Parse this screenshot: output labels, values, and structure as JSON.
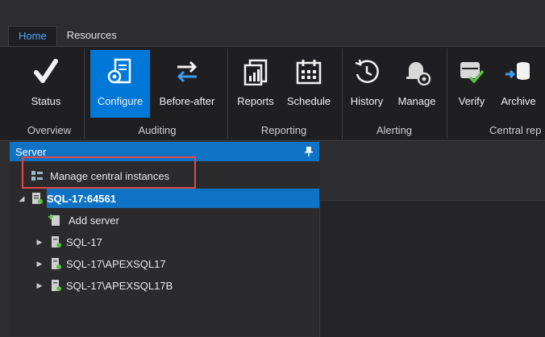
{
  "tabs": [
    {
      "label": "Home",
      "active": true
    },
    {
      "label": "Resources",
      "active": false
    }
  ],
  "ribbon": {
    "buttons": [
      {
        "label": "Status",
        "icon": "checkmark-icon"
      },
      {
        "label": "Configure",
        "icon": "server-gear-icon",
        "selected": true
      },
      {
        "label": "Before-after",
        "icon": "swap-arrows-icon"
      },
      {
        "label": "Reports",
        "icon": "report-chart-icon"
      },
      {
        "label": "Schedule",
        "icon": "calendar-icon"
      },
      {
        "label": "History",
        "icon": "history-clock-icon"
      },
      {
        "label": "Manage",
        "icon": "bell-gear-icon"
      },
      {
        "label": "Verify",
        "icon": "server-check-icon"
      },
      {
        "label": "Archive",
        "icon": "archive-database-icon"
      }
    ],
    "groups": [
      {
        "label": "Overview"
      },
      {
        "label": "Auditing"
      },
      {
        "label": "Reporting"
      },
      {
        "label": "Alerting"
      },
      {
        "label": "Central rep"
      }
    ]
  },
  "server_panel": {
    "title": "Server",
    "items": [
      {
        "label": "Manage central instances",
        "icon": "server-list-icon"
      },
      {
        "label": "SQL-17:64561",
        "icon": "server-icon",
        "expanded": true,
        "selected": true
      },
      {
        "label": "Add server",
        "icon": "add-server-icon"
      },
      {
        "label": "SQL-17",
        "icon": "instance-icon"
      },
      {
        "label": "SQL-17\\APEXSQL17",
        "icon": "instance-icon"
      },
      {
        "label": "SQL-17\\APEXSQL17B",
        "icon": "instance-icon"
      }
    ]
  },
  "colors": {
    "accent": "#0f73c5",
    "highlight_box": "#e04a4a",
    "background": "#2d2d30"
  }
}
